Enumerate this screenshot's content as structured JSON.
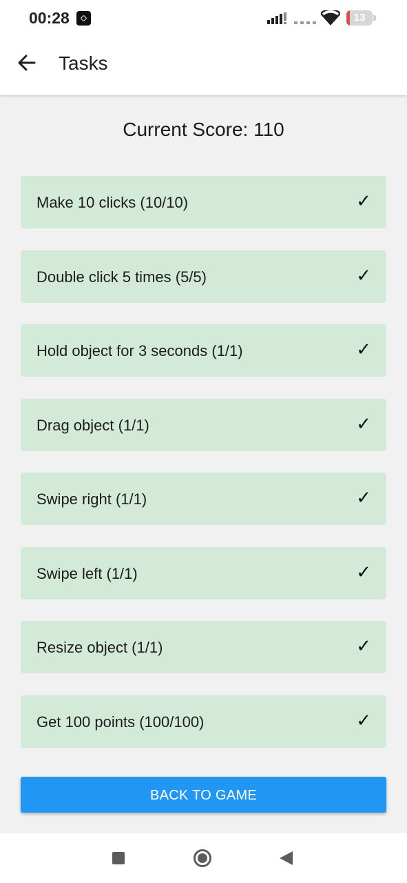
{
  "status_bar": {
    "time": "00:28",
    "battery_level": "13",
    "battery_color": "#e54b4b",
    "icons": [
      "app-notification-icon",
      "signal-icon",
      "dots-icon",
      "wifi-icon",
      "battery-icon"
    ]
  },
  "app_bar": {
    "title": "Tasks",
    "back_icon": "arrow-back-icon"
  },
  "score": {
    "text": "Current Score: 110"
  },
  "tasks": [
    {
      "label": "Make 10 clicks (10/10)",
      "check": "✓"
    },
    {
      "label": "Double click 5 times (5/5)",
      "check": "✓"
    },
    {
      "label": "Hold object for 3 seconds (1/1)",
      "check": "✓"
    },
    {
      "label": "Drag object (1/1)",
      "check": "✓"
    },
    {
      "label": "Swipe right (1/1)",
      "check": "✓"
    },
    {
      "label": "Swipe left (1/1)",
      "check": "✓"
    },
    {
      "label": "Resize object (1/1)",
      "check": "✓"
    },
    {
      "label": "Get 100 points (100/100)",
      "check": "✓"
    }
  ],
  "actions": {
    "back_to_game": "BACK TO GAME"
  },
  "colors": {
    "task_background": "#d4ead9",
    "button_background": "#2196f3",
    "page_background": "#f1f1f1"
  },
  "nav_bar": {
    "icons": [
      "recents-square-icon",
      "home-circle-icon",
      "back-triangle-icon"
    ]
  }
}
